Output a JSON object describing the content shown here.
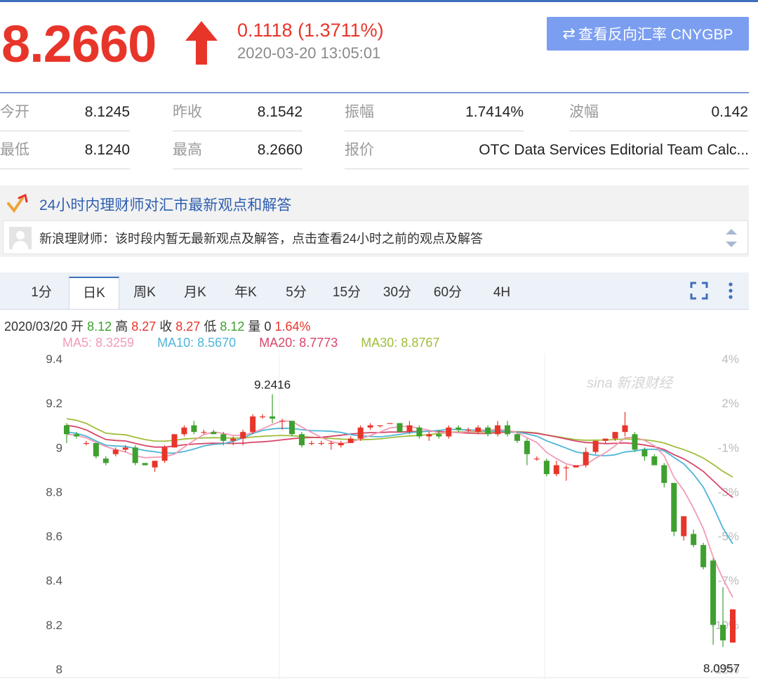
{
  "quote": {
    "price": "8.2660",
    "change": "0.1118 (1.3711%)",
    "timestamp": "2020-03-20 13:05:01",
    "reverse_button": "查看反向汇率 CNYGBP"
  },
  "stats": {
    "open_label": "今开",
    "open_value": "8.1245",
    "prev_close_label": "昨收",
    "prev_close_value": "8.1542",
    "amplitude_label": "振幅",
    "amplitude_value": "1.7414%",
    "wave_label": "波幅",
    "wave_value": "0.142",
    "low_label": "最低",
    "low_value": "8.1240",
    "high_label": "最高",
    "high_value": "8.2660",
    "quote_label": "报价",
    "quote_value": "OTC Data Services Editorial Team Calc..."
  },
  "advisor": {
    "title": "24小时内理财师对汇市最新观点和解答",
    "message": "新浪理财师：该时段内暂无最新观点及解答，点击查看24小时之前的观点及解答"
  },
  "tabs": [
    "1分",
    "日K",
    "周K",
    "月K",
    "年K",
    "5分",
    "15分",
    "30分",
    "60分",
    "4H"
  ],
  "active_tab": "日K",
  "ohlc": {
    "date": "2020/03/20",
    "open_label": "开",
    "open": "8.12",
    "high_label": "高",
    "high": "8.27",
    "close_label": "收",
    "close": "8.27",
    "low_label": "低",
    "low": "8.12",
    "volume_label": "量",
    "volume": "0",
    "pct": "1.64%"
  },
  "ma": {
    "ma5": "MA5: 8.3259",
    "ma10": "MA10: 8.5670",
    "ma20": "MA20: 8.7773",
    "ma30": "MA30: 8.8767"
  },
  "colors": {
    "up": "#e8352a",
    "down": "#3ea02f",
    "ma5": "#f29bb5",
    "ma10": "#4fb5d8",
    "ma20": "#d8466a",
    "ma30": "#9fbe3a"
  },
  "watermark": "sina 新浪财经",
  "chart_data": {
    "type": "candlestick",
    "y_ticks": [
      "9.4",
      "9.2",
      "9",
      "8.8",
      "8.6",
      "8.4",
      "8.2",
      "8"
    ],
    "y_right_ticks": [
      "4%",
      "2%",
      "-1%",
      "-3%",
      "-5%",
      "-7%",
      "-10%",
      "-12%"
    ],
    "ylim": [
      8.0,
      9.4
    ],
    "max_label": "9.2416",
    "min_label": "8.0957",
    "candles": [
      {
        "o": 9.1,
        "h": 9.11,
        "l": 9.02,
        "c": 9.06
      },
      {
        "o": 9.06,
        "h": 9.07,
        "l": 9.04,
        "c": 9.05
      },
      {
        "o": 9.02,
        "h": 9.03,
        "l": 9.01,
        "c": 9.02
      },
      {
        "o": 9.02,
        "h": 9.02,
        "l": 8.95,
        "c": 8.96
      },
      {
        "o": 8.95,
        "h": 8.96,
        "l": 8.92,
        "c": 8.93
      },
      {
        "o": 8.97,
        "h": 9.0,
        "l": 8.96,
        "c": 8.99
      },
      {
        "o": 8.99,
        "h": 9.01,
        "l": 8.98,
        "c": 9.0
      },
      {
        "o": 9.0,
        "h": 9.01,
        "l": 8.92,
        "c": 8.93
      },
      {
        "o": 8.93,
        "h": 8.93,
        "l": 8.92,
        "c": 8.92
      },
      {
        "o": 8.91,
        "h": 8.94,
        "l": 8.89,
        "c": 8.94
      },
      {
        "o": 8.94,
        "h": 9.01,
        "l": 8.93,
        "c": 9.0
      },
      {
        "o": 9.0,
        "h": 9.06,
        "l": 9.0,
        "c": 9.06
      },
      {
        "o": 9.06,
        "h": 9.1,
        "l": 9.05,
        "c": 9.09
      },
      {
        "o": 9.1,
        "h": 9.12,
        "l": 9.06,
        "c": 9.07
      },
      {
        "o": 9.07,
        "h": 9.08,
        "l": 9.06,
        "c": 9.07
      },
      {
        "o": 9.07,
        "h": 9.08,
        "l": 9.06,
        "c": 9.06
      },
      {
        "o": 9.06,
        "h": 9.07,
        "l": 9.01,
        "c": 9.03
      },
      {
        "o": 9.03,
        "h": 9.05,
        "l": 9.01,
        "c": 9.04
      },
      {
        "o": 9.04,
        "h": 9.08,
        "l": 9.01,
        "c": 9.07
      },
      {
        "o": 9.07,
        "h": 9.15,
        "l": 9.06,
        "c": 9.14
      },
      {
        "o": 9.14,
        "h": 9.15,
        "l": 9.13,
        "c": 9.14
      },
      {
        "o": 9.14,
        "h": 9.24,
        "l": 9.11,
        "c": 9.13
      },
      {
        "o": 9.12,
        "h": 9.13,
        "l": 9.08,
        "c": 9.12
      },
      {
        "o": 9.12,
        "h": 9.12,
        "l": 9.05,
        "c": 9.06
      },
      {
        "o": 9.06,
        "h": 9.07,
        "l": 9.0,
        "c": 9.01
      },
      {
        "o": 9.02,
        "h": 9.03,
        "l": 9.01,
        "c": 9.02
      },
      {
        "o": 9.02,
        "h": 9.03,
        "l": 9.01,
        "c": 9.02
      },
      {
        "o": 9.02,
        "h": 9.03,
        "l": 8.99,
        "c": 9.02
      },
      {
        "o": 9.01,
        "h": 9.03,
        "l": 9.0,
        "c": 9.02
      },
      {
        "o": 9.02,
        "h": 9.05,
        "l": 9.02,
        "c": 9.04
      },
      {
        "o": 9.04,
        "h": 9.1,
        "l": 9.03,
        "c": 9.09
      },
      {
        "o": 9.09,
        "h": 9.11,
        "l": 9.08,
        "c": 9.1
      },
      {
        "o": 9.1,
        "h": 9.1,
        "l": 9.09,
        "c": 9.1
      },
      {
        "o": 9.11,
        "h": 9.11,
        "l": 9.11,
        "c": 9.11
      },
      {
        "o": 9.11,
        "h": 9.11,
        "l": 9.07,
        "c": 9.07
      },
      {
        "o": 9.07,
        "h": 9.12,
        "l": 9.06,
        "c": 9.1
      },
      {
        "o": 9.09,
        "h": 9.1,
        "l": 9.04,
        "c": 9.05
      },
      {
        "o": 9.05,
        "h": 9.07,
        "l": 9.03,
        "c": 9.06
      },
      {
        "o": 9.06,
        "h": 9.08,
        "l": 9.04,
        "c": 9.05
      },
      {
        "o": 9.05,
        "h": 9.1,
        "l": 9.04,
        "c": 9.09
      },
      {
        "o": 9.09,
        "h": 9.1,
        "l": 9.07,
        "c": 9.08
      },
      {
        "o": 9.08,
        "h": 9.09,
        "l": 9.07,
        "c": 9.08
      },
      {
        "o": 9.07,
        "h": 9.1,
        "l": 9.06,
        "c": 9.09
      },
      {
        "o": 9.09,
        "h": 9.1,
        "l": 9.05,
        "c": 9.06
      },
      {
        "o": 9.06,
        "h": 9.12,
        "l": 9.05,
        "c": 9.1
      },
      {
        "o": 9.1,
        "h": 9.12,
        "l": 9.05,
        "c": 9.06
      },
      {
        "o": 9.06,
        "h": 9.07,
        "l": 9.02,
        "c": 9.03
      },
      {
        "o": 9.03,
        "h": 9.04,
        "l": 8.92,
        "c": 8.97
      },
      {
        "o": 8.95,
        "h": 8.96,
        "l": 8.94,
        "c": 8.95
      },
      {
        "o": 8.94,
        "h": 8.95,
        "l": 8.87,
        "c": 8.88
      },
      {
        "o": 8.88,
        "h": 8.94,
        "l": 8.87,
        "c": 8.92
      },
      {
        "o": 8.91,
        "h": 8.92,
        "l": 8.85,
        "c": 8.91
      },
      {
        "o": 8.91,
        "h": 8.92,
        "l": 8.91,
        "c": 8.92
      },
      {
        "o": 8.92,
        "h": 9.0,
        "l": 8.91,
        "c": 8.98
      },
      {
        "o": 8.98,
        "h": 9.03,
        "l": 8.97,
        "c": 9.03
      },
      {
        "o": 9.03,
        "h": 9.04,
        "l": 9.02,
        "c": 9.04
      },
      {
        "o": 9.04,
        "h": 9.07,
        "l": 9.03,
        "c": 9.07
      },
      {
        "o": 9.07,
        "h": 9.16,
        "l": 9.05,
        "c": 9.1
      },
      {
        "o": 9.06,
        "h": 9.07,
        "l": 8.98,
        "c": 8.99
      },
      {
        "o": 8.99,
        "h": 9.0,
        "l": 8.94,
        "c": 8.96
      },
      {
        "o": 8.96,
        "h": 8.97,
        "l": 8.92,
        "c": 8.92
      },
      {
        "o": 8.92,
        "h": 8.93,
        "l": 8.82,
        "c": 8.84
      },
      {
        "o": 8.84,
        "h": 8.84,
        "l": 8.6,
        "c": 8.62
      },
      {
        "o": 8.6,
        "h": 8.69,
        "l": 8.58,
        "c": 8.69
      },
      {
        "o": 8.61,
        "h": 8.63,
        "l": 8.55,
        "c": 8.56
      },
      {
        "o": 8.56,
        "h": 8.57,
        "l": 8.45,
        "c": 8.46
      },
      {
        "o": 8.49,
        "h": 8.5,
        "l": 8.11,
        "c": 8.2
      },
      {
        "o": 8.2,
        "h": 8.37,
        "l": 8.1,
        "c": 8.13
      },
      {
        "o": 8.12,
        "h": 8.27,
        "l": 8.12,
        "c": 8.27
      }
    ]
  }
}
